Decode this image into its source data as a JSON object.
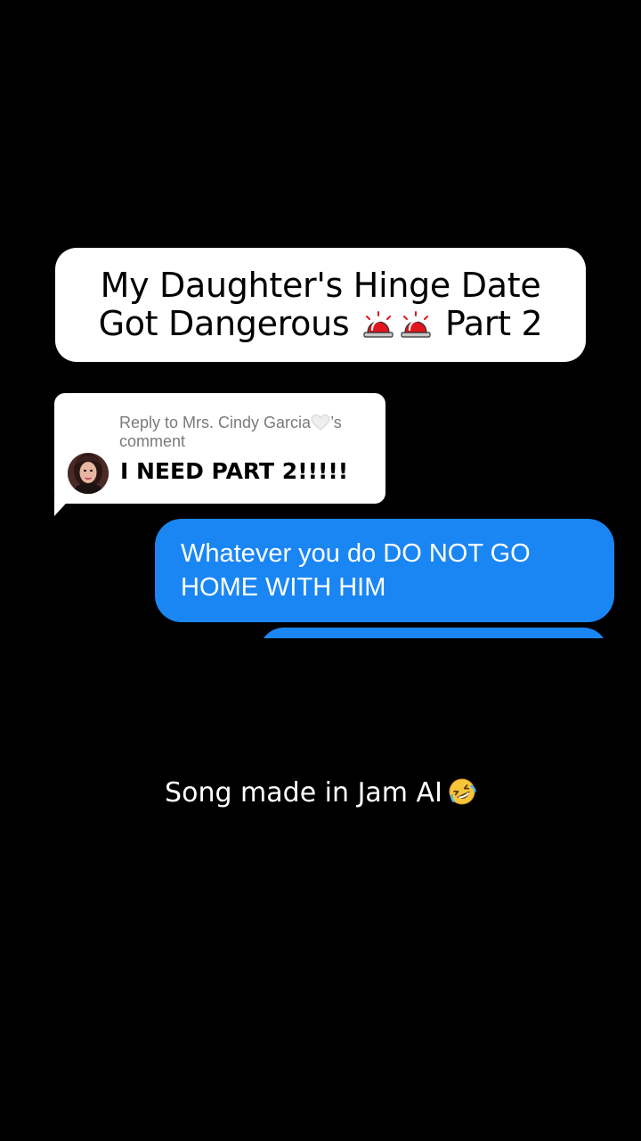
{
  "title_card": {
    "line1": "My Daughter's Hinge Date",
    "line2_start": "Got Dangerous",
    "line2_end": "Part 2",
    "emoji": "police-siren-icon",
    "emoji_count": 2
  },
  "reply": {
    "prefix": "Reply to Mrs. Cindy Garcia",
    "suffix": "’s",
    "line2": "comment",
    "heart_icon": "white-heart-icon",
    "comment_text": "I NEED PART 2!!!!!"
  },
  "message": {
    "text": "Whatever you do DO NOT GO\nHOME WITH HIM",
    "bubble_color": "#1a86f4"
  },
  "caption": {
    "text": "Song made in Jam AI",
    "emoji": "rolling-on-floor-laughing-icon"
  },
  "colors": {
    "background": "#000000",
    "card": "#ffffff",
    "imessage_blue": "#1a86f4"
  }
}
